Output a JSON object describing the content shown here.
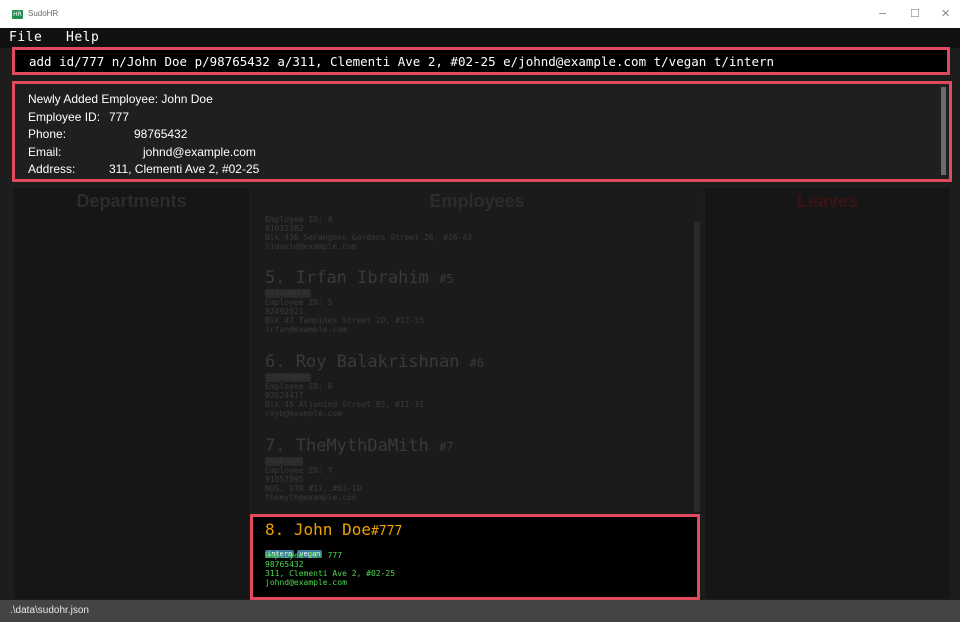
{
  "window": {
    "title": "SudoHR",
    "app_icon_text": "HR",
    "minimize": "−",
    "maximize": "☐",
    "close": "✕"
  },
  "menu": {
    "file": "File",
    "help": "Help"
  },
  "command": {
    "value": "add id/777 n/John Doe p/98765432 a/311, Clementi Ave 2, #02-25 e/johnd@example.com t/vegan t/intern"
  },
  "result": {
    "line1": "Newly Added Employee: John Doe",
    "id_label": "Employee ID:",
    "id_value": "777",
    "phone_label": "Phone:",
    "phone_value": "98765432",
    "email_label": "Email:",
    "email_value": "johnd@example.com",
    "address_label": "Address:",
    "address_value": "311, Clementi Ave 2, #02-25"
  },
  "panels": {
    "departments": "Departments",
    "employees": "Employees",
    "leaves": "Leaves"
  },
  "employees": [
    {
      "index": "5.",
      "name": "Irfan Ibrahim",
      "id_tag": "#5",
      "tag": "classmates",
      "id_line": "Employee ID: 5",
      "phone": "92492021",
      "address": "Blk 47 Tampines Street 20, #17-35",
      "email": "irfan@example.com"
    },
    {
      "index": "6.",
      "name": "Roy Balakrishnan",
      "id_tag": "#6",
      "tag": "colleagues",
      "id_line": "Employee ID: 6",
      "phone": "92624417",
      "address": "Blk 45 Aljunied Street 85, #11-31",
      "email": "royb@example.com"
    },
    {
      "index": "7.",
      "name": "TheMythDaMith",
      "id_tag": "#7",
      "tag": "nonbinar",
      "id_line": "Employee ID: 7",
      "phone": "91057895",
      "address": "NUS, UTR #17, #03-10",
      "email": "themyth@example.com"
    }
  ],
  "above_card": {
    "id_line": "Employee ID: 4",
    "phone": "91031282",
    "address": "Blk 436 Serangoon Gardens Street 26, #16-43",
    "email": "lidavid@example.com"
  },
  "featured": {
    "index": "8.",
    "name": "John Doe",
    "id_tag": "#777",
    "tags": [
      "intern",
      "vegan"
    ],
    "id_line": "Employee ID: 777",
    "phone": "98765432",
    "address": "311, Clementi Ave 2, #02-25",
    "email": "johnd@example.com"
  },
  "status": {
    "path": ".\\data\\sudohr.json"
  },
  "colors": {
    "accent": "#e04a5e",
    "name_gold": "#f0a000",
    "detail_green": "#4bd84b",
    "tag_blue": "#3d7a9c"
  }
}
